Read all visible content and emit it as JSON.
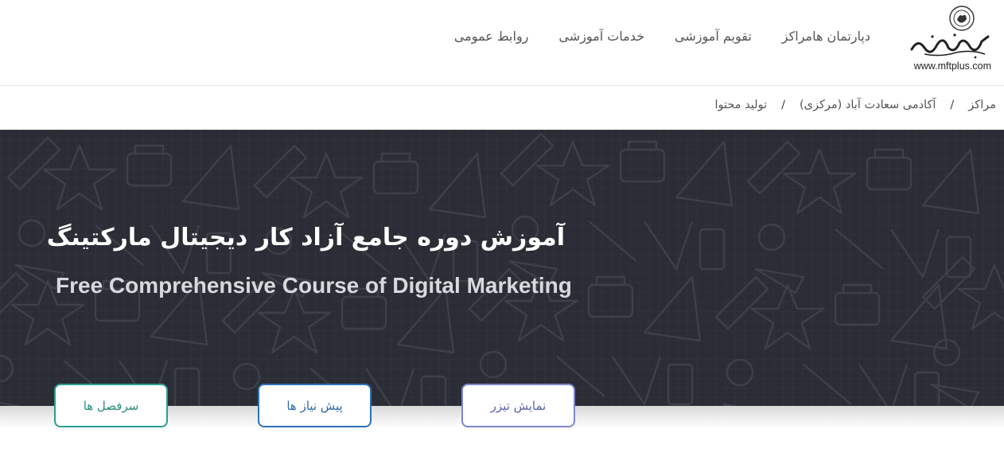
{
  "header": {
    "logo": {
      "script_text": "مجتمع فنی تهران",
      "url": "www.mftplus.com"
    },
    "nav": [
      "دپارتمان ها",
      "مراکز",
      "تقویم آموزشی",
      "خدمات آموزشی",
      "روابط عمومی"
    ]
  },
  "breadcrumb": [
    "مراکز",
    "آکادمی سعادت آباد (مرکزی)",
    "تولید محتوا"
  ],
  "breadcrumb_separator": "/",
  "hero": {
    "title_fa": "آموزش دوره جامع آزاد کار دیجیتال مارکتینگ",
    "title_en": "Free Comprehensive Course of Digital Marketing"
  },
  "buttons": {
    "syllabus": "سرفصل ها",
    "prerequisites": "پیش نیاز ها",
    "teaser": "نمایش تیزر"
  },
  "colors": {
    "hero_bg": "#2b2d36",
    "syllabus_border": "#2a9d8f",
    "prerequisites_border": "#2c72b8",
    "teaser_border": "#7d86c9"
  }
}
